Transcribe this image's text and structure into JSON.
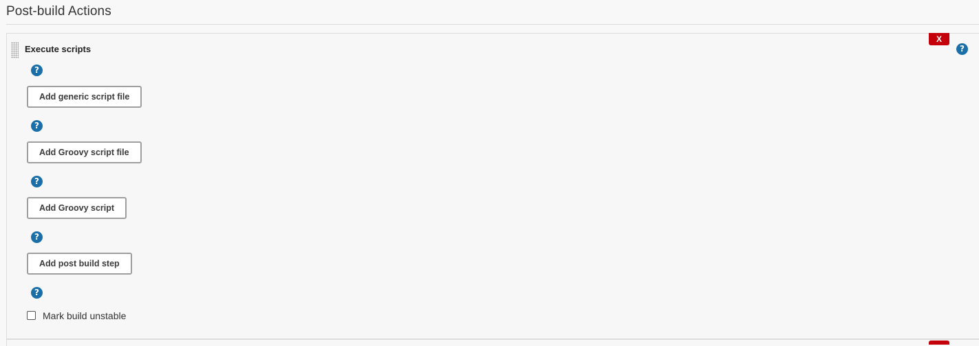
{
  "section": {
    "title": "Post-build Actions"
  },
  "execute_scripts": {
    "title": "Execute scripts",
    "delete_label": "X",
    "help_glyph": "?",
    "buttons": [
      {
        "label": "Add generic script file"
      },
      {
        "label": "Add Groovy script file"
      },
      {
        "label": "Add Groovy script"
      },
      {
        "label": "Add post build step"
      }
    ],
    "mark_unstable": {
      "label": "Mark build unstable",
      "checked": false
    }
  },
  "colors": {
    "delete_button": "#c4000a",
    "help_icon": "#1b6fa8",
    "background": "#f8f8f8"
  }
}
